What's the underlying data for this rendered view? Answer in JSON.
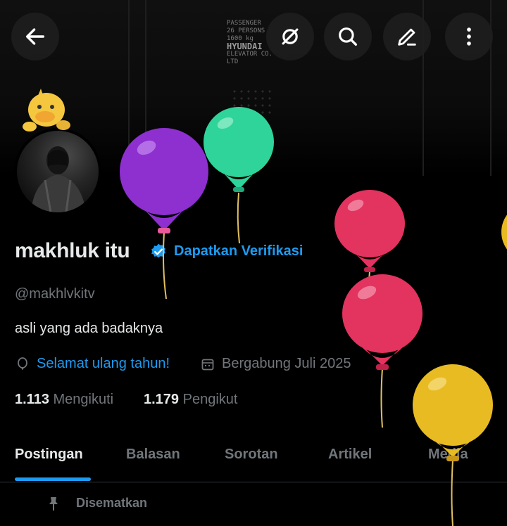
{
  "banner": {
    "plate_lines": [
      "PASSENGER",
      "26 PERSONS",
      "1600   kg",
      "HYUNDAI",
      "ELEVATOR CO. LTD"
    ]
  },
  "header": {
    "back_icon": "arrow-left-icon",
    "notify_icon": "notification-off-icon",
    "search_icon": "search-icon",
    "edit_icon": "pencil-icon",
    "more_icon": "more-vertical-icon"
  },
  "profile": {
    "display_name": "makhluk itu",
    "verify_label": "Dapatkan Verifikasi",
    "handle": "@makhlvkitv",
    "bio": "asli yang ada badaknya",
    "birthday_label": "Selamat ulang tahun!",
    "joined_label": "Bergabung Juli 2025",
    "following_count": "1.113",
    "following_label": "Mengikuti",
    "followers_count": "1.179",
    "followers_label": "Pengikut"
  },
  "tabs": [
    {
      "label": "Postingan"
    },
    {
      "label": "Balasan"
    },
    {
      "label": "Sorotan"
    },
    {
      "label": "Artikel"
    },
    {
      "label": "Media"
    }
  ],
  "pinned_label": "Disematkan",
  "colors": {
    "accent": "#1d9bf0",
    "muted": "#71767b",
    "text": "#e7e9ea",
    "balloon_purple": "#8e2fd0",
    "balloon_green": "#2fd49a",
    "balloon_red": "#e3335f",
    "balloon_yellow": "#e8bb22"
  }
}
